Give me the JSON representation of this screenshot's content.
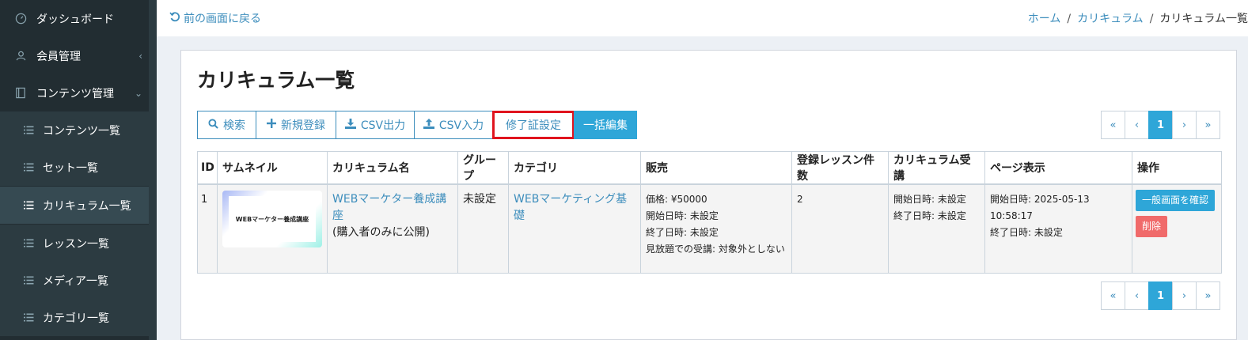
{
  "sidebar": {
    "items": [
      {
        "label": "ダッシュボード",
        "icon": "dashboard-icon"
      },
      {
        "label": "会員管理",
        "icon": "users-icon",
        "caret": "‹"
      },
      {
        "label": "コンテンツ管理",
        "icon": "book-icon",
        "caret": "⌄"
      },
      {
        "label": "コンテンツ一覧",
        "icon": "list-icon"
      },
      {
        "label": "セット一覧",
        "icon": "list-icon"
      },
      {
        "label": "カリキュラム一覧",
        "icon": "list-icon"
      },
      {
        "label": "レッスン一覧",
        "icon": "list-icon"
      },
      {
        "label": "メディア一覧",
        "icon": "list-icon"
      },
      {
        "label": "カテゴリ一覧",
        "icon": "list-icon"
      }
    ]
  },
  "topbar": {
    "back_label": "前の画面に戻る",
    "breadcrumb": [
      "ホーム",
      "カリキュラム",
      "カリキュラム一覧"
    ]
  },
  "page": {
    "title": "カリキュラム一覧"
  },
  "toolbar": {
    "search": "検索",
    "new": "新規登録",
    "csv_export": "CSV出力",
    "csv_import": "CSV入力",
    "certificate": "修了証設定",
    "bulk_edit": "一括編集"
  },
  "pagination": {
    "first": "«",
    "prev": "‹",
    "current": "1",
    "next": "›",
    "last": "»"
  },
  "table": {
    "headers": [
      "ID",
      "サムネイル",
      "カリキュラム名",
      "グループ",
      "カテゴリ",
      "販売",
      "登録レッスン件数",
      "カリキュラム受講",
      "ページ表示",
      "操作"
    ],
    "rows": [
      {
        "id": "1",
        "thumbnail_text": "WEBマーケター養成講座",
        "name": "WEBマーケター養成講座",
        "visibility": "(購入者のみに公開)",
        "group": "未設定",
        "category": "WEBマーケティング基礎",
        "sale": [
          "価格: ¥50000",
          "開始日時: 未設定",
          "終了日時: 未設定",
          "見放題での受講: 対象外としない"
        ],
        "lesson_count": "2",
        "attendance": [
          "開始日時: 未設定",
          "終了日時: 未設定"
        ],
        "page_display": [
          "開始日時: 2025-05-13 10:58:17",
          "終了日時: 未設定"
        ],
        "actions": {
          "view": "一般画面を確認",
          "delete": "削除"
        }
      }
    ]
  },
  "colors": {
    "sidebar_bg": "#222d32",
    "accent": "#2ea6d8",
    "link": "#3c8dbc",
    "highlight_border": "#e0141e",
    "danger": "#f06a6a"
  }
}
